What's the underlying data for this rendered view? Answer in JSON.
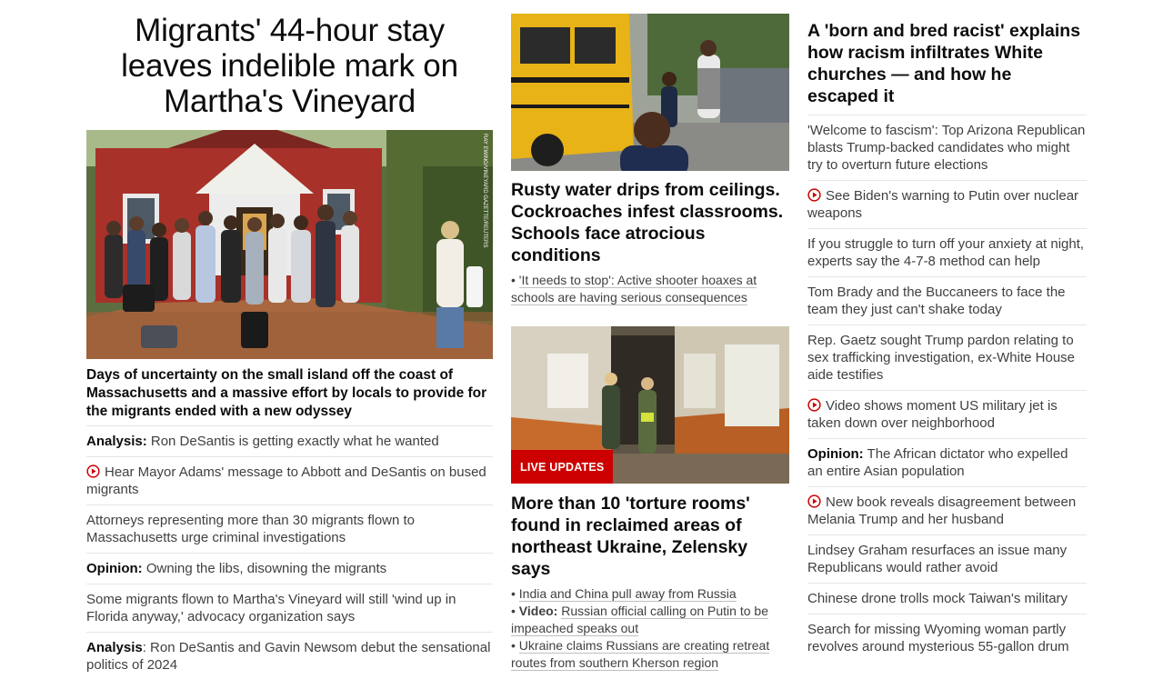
{
  "column1": {
    "headline": "Migrants' 44-hour stay leaves indelible mark on Martha's Vineyard",
    "image_credit": "RAY EWING/VINEYARD GAZETTE/REUTERS",
    "subheadline": "Days of uncertainty on the small island off the coast of Massachusetts and a massive effort by locals to provide for the migrants ended with a new odyssey",
    "items": [
      {
        "prefix": "Analysis:",
        "text": " Ron DeSantis is getting exactly what he wanted",
        "video": false
      },
      {
        "prefix": "",
        "text": "Hear Mayor Adams' message to Abbott and DeSantis on bused migrants",
        "video": true
      },
      {
        "prefix": "",
        "text": "Attorneys representing more than 30 migrants flown to Massachusetts urge criminal investigations",
        "video": false
      },
      {
        "prefix": "Opinion:",
        "text": " Owning the libs, disowning the migrants",
        "video": false
      },
      {
        "prefix": "",
        "text": "Some migrants flown to Martha's Vineyard will still 'wind up in Florida anyway,' advocacy organization says",
        "video": false
      },
      {
        "prefix": "Analysis",
        "text": ": Ron DeSantis and Gavin Newsom debut the sensational politics of 2024",
        "video": false
      }
    ]
  },
  "column2": {
    "story1": {
      "headline": "Rusty water drips from ceilings. Cockroaches infest classrooms. Schools face atrocious conditions",
      "bullets": [
        {
          "prefix": "",
          "text": "'It needs to stop': Active shooter hoaxes at schools are having serious consequences"
        }
      ]
    },
    "story2": {
      "badge": "LIVE UPDATES",
      "headline": "More than 10 'torture rooms' found in reclaimed areas of northeast Ukraine, Zelensky says",
      "bullets": [
        {
          "prefix": "",
          "text": "India and China pull away from Russia"
        },
        {
          "prefix": "Video:",
          "text": "Russian official calling on Putin to be impeached speaks out"
        },
        {
          "prefix": "",
          "text": "Ukraine claims Russians are creating retreat routes from southern Kherson region"
        }
      ]
    }
  },
  "column3": {
    "headline": "A 'born and bred racist' explains how racism infiltrates White churches — and how he escaped it",
    "items": [
      {
        "prefix": "",
        "text": "'Welcome to fascism': Top Arizona Republican blasts Trump-backed candidates who might try to overturn future elections",
        "video": false
      },
      {
        "prefix": "",
        "text": "See Biden's warning to Putin over nuclear weapons",
        "video": true
      },
      {
        "prefix": "",
        "text": "If you struggle to turn off your anxiety at night, experts say the 4-7-8 method can help",
        "video": false
      },
      {
        "prefix": "",
        "text": "Tom Brady and the Buccaneers to face the team they just can't shake today",
        "video": false
      },
      {
        "prefix": "",
        "text": "Rep. Gaetz sought Trump pardon relating to sex trafficking investigation, ex-White House aide testifies",
        "video": false
      },
      {
        "prefix": "",
        "text": "Video shows moment US military jet is taken down over neighborhood",
        "video": true
      },
      {
        "prefix": "Opinion:",
        "text": " The African dictator who expelled an entire Asian population",
        "video": false
      },
      {
        "prefix": "",
        "text": "New book reveals disagreement between Melania Trump and her husband",
        "video": true
      },
      {
        "prefix": "",
        "text": "Lindsey Graham resurfaces an issue many Republicans would rather avoid",
        "video": false
      },
      {
        "prefix": "",
        "text": "Chinese drone trolls mock Taiwan's military",
        "video": false
      },
      {
        "prefix": "",
        "text": "Search for missing Wyoming woman partly revolves around mysterious 55-gallon drum",
        "video": false
      }
    ]
  },
  "colors": {
    "live_red": "#cc0000",
    "video_icon_red": "#cc0000",
    "divider": "#e6e6e6"
  },
  "icons": {
    "video": "play-circle-icon"
  }
}
